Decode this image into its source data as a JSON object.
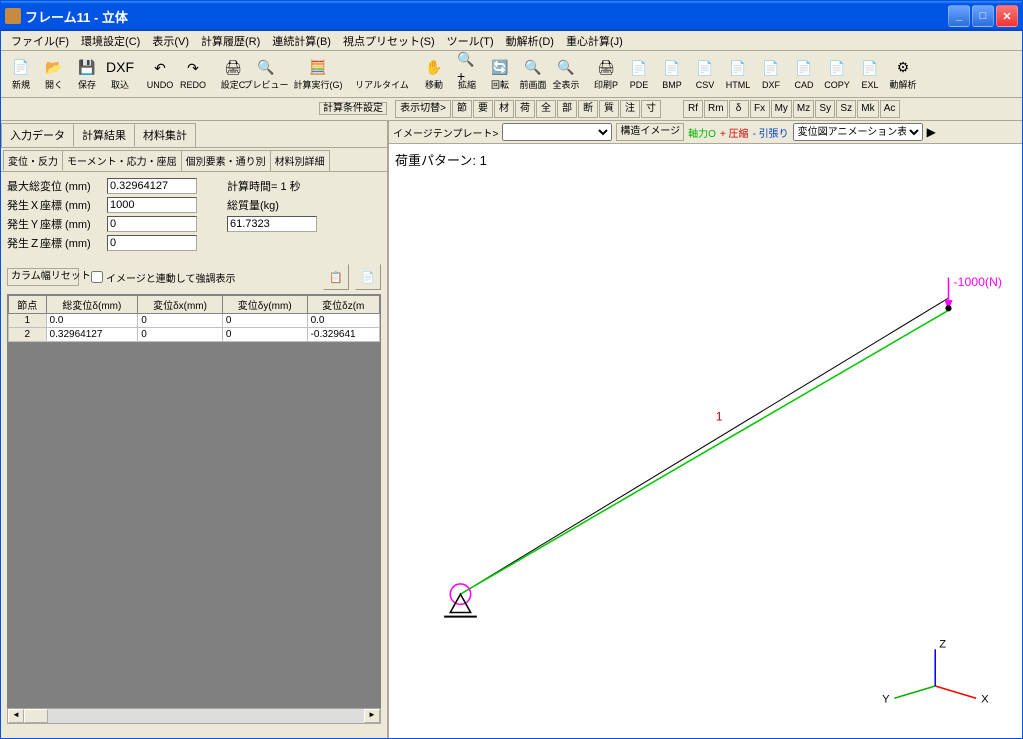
{
  "title": "フレーム11 - 立体",
  "menu": [
    "ファイル(F)",
    "環境設定(C)",
    "表示(V)",
    "計算履歴(R)",
    "連続計算(B)",
    "視点プリセット(S)",
    "ツール(T)",
    "動解析(D)",
    "重心計算(J)"
  ],
  "toolbar": [
    {
      "label": "新規",
      "icon": "📄"
    },
    {
      "label": "開く",
      "icon": "📂"
    },
    {
      "label": "保存",
      "icon": "💾"
    },
    {
      "label": "取込",
      "icon": "DXF"
    },
    {
      "label": "UNDO",
      "icon": "↶"
    },
    {
      "label": "REDO",
      "icon": "↷"
    },
    {
      "label": "設定C",
      "icon": "🖨"
    },
    {
      "label": "プレビュー",
      "icon": "🔍"
    },
    {
      "label": "計算実行(G)",
      "icon": "🧮"
    },
    {
      "label": "リアルタイム",
      "icon": ""
    },
    {
      "label": "移動",
      "icon": "✋"
    },
    {
      "label": "拡縮",
      "icon": "🔍+"
    },
    {
      "label": "回転",
      "icon": "🔄"
    },
    {
      "label": "前画面",
      "icon": "🔍"
    },
    {
      "label": "全表示",
      "icon": "🔍"
    },
    {
      "label": "印刷P",
      "icon": "🖨"
    },
    {
      "label": "PDE",
      "icon": "📄"
    },
    {
      "label": "BMP",
      "icon": "📄"
    },
    {
      "label": "CSV",
      "icon": "📄"
    },
    {
      "label": "HTML",
      "icon": "📄"
    },
    {
      "label": "DXF",
      "icon": "📄"
    },
    {
      "label": "CAD",
      "icon": "📄"
    },
    {
      "label": "COPY",
      "icon": "📄"
    },
    {
      "label": "EXL",
      "icon": "📄"
    },
    {
      "label": "動解析",
      "icon": "⚙"
    }
  ],
  "subbar_left": "計算条件設定",
  "subbar_items": [
    "表示切替>",
    "節",
    "要",
    "材",
    "荷",
    "全",
    "部",
    "断",
    "質",
    "注",
    "寸",
    "",
    "Rf",
    "Rm",
    "δ",
    "Fx",
    "My",
    "Mz",
    "Sy",
    "Sz",
    "Mk",
    "Ac"
  ],
  "left_tabs": [
    "入力データ",
    "計算結果",
    "材料集計"
  ],
  "left_tab_active": 1,
  "sub_tabs": [
    "変位・反力",
    "モーメント・応力・座屈",
    "個別要素・通り別",
    "材料別詳細"
  ],
  "sub_tab_active": 0,
  "fields": {
    "max_disp_label": "最大総変位 (mm)",
    "max_disp": "0.32964127",
    "time_label": "計算時間= 1 秒",
    "x_label": "発生Ｘ座標 (mm)",
    "x": "1000",
    "mass_label": "総質量(kg)",
    "y_label": "発生Ｙ座標 (mm)",
    "y": "0",
    "mass": "61.7323",
    "z_label": "発生Ｚ座標 (mm)",
    "z": "0"
  },
  "col_reset": "カラム幅リセット",
  "sync_check": "イメージと連動して強調表示",
  "grid": {
    "headers": [
      "節点",
      "総変位δ(mm)",
      "変位δx(mm)",
      "変位δy(mm)",
      "変位δz(m"
    ],
    "rows": [
      [
        "1",
        "0.0",
        "0",
        "0",
        "0.0"
      ],
      [
        "2",
        "0.32964127",
        "0",
        "0",
        "-0.329641"
      ]
    ]
  },
  "rtop": {
    "template_label": "イメージテンプレート>",
    "struct_label": "構造イメージ",
    "axial": "軸力O",
    "comp": "+ 圧縮",
    "tens": "- 引張り",
    "dropdown": "変位図アニメーション表示"
  },
  "canvas": {
    "pattern_label": "荷重パターン:  1",
    "load_label": "-1000(N)",
    "member_num": "1",
    "axes": {
      "x": "X",
      "y": "Y",
      "z": "Z"
    }
  }
}
